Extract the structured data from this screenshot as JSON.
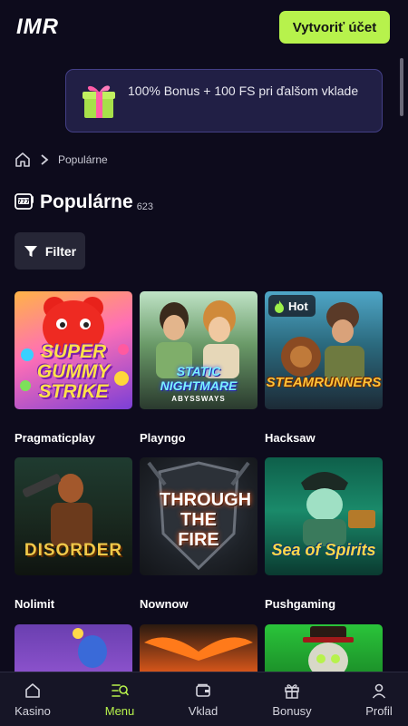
{
  "header": {
    "logo": "IMR",
    "cta_label": "Vytvoriť účet"
  },
  "promo": {
    "text": "100% Bonus + 100 FS pri ďalšom vklade"
  },
  "breadcrumb": {
    "current": "Populárne"
  },
  "page": {
    "title": "Populárne",
    "count": "623"
  },
  "filter": {
    "label": "Filter"
  },
  "games": [
    {
      "title": "SUPER GUMMY STRIKE",
      "hot": false
    },
    {
      "title": "STATIC NIGHTMARE",
      "subtitle": "ABYSSWAYS",
      "hot": false
    },
    {
      "title": "STEAMRUNNERS",
      "hot": true,
      "hot_label": "Hot"
    },
    {
      "title": "DISORDER",
      "hot": false
    },
    {
      "title": "THROUGH THE FIRE",
      "hot": false
    },
    {
      "title": "Sea of Spirits",
      "hot": false
    }
  ],
  "providers": [
    "Pragmaticplay",
    "Playngo",
    "Hacksaw",
    "Nolimit",
    "Nownow",
    "Pushgaming"
  ],
  "nav": [
    {
      "label": "Kasino",
      "icon": "home-icon",
      "active": false
    },
    {
      "label": "Menu",
      "icon": "menu-search-icon",
      "active": true
    },
    {
      "label": "Vklad",
      "icon": "wallet-icon",
      "active": false
    },
    {
      "label": "Bonusy",
      "icon": "gift-icon",
      "active": false
    },
    {
      "label": "Profil",
      "icon": "user-icon",
      "active": false
    }
  ],
  "colors": {
    "background": "#0d0b1c",
    "accent": "#b7f24c",
    "promo_bg": "#211f45",
    "nav_bg": "#161526"
  }
}
